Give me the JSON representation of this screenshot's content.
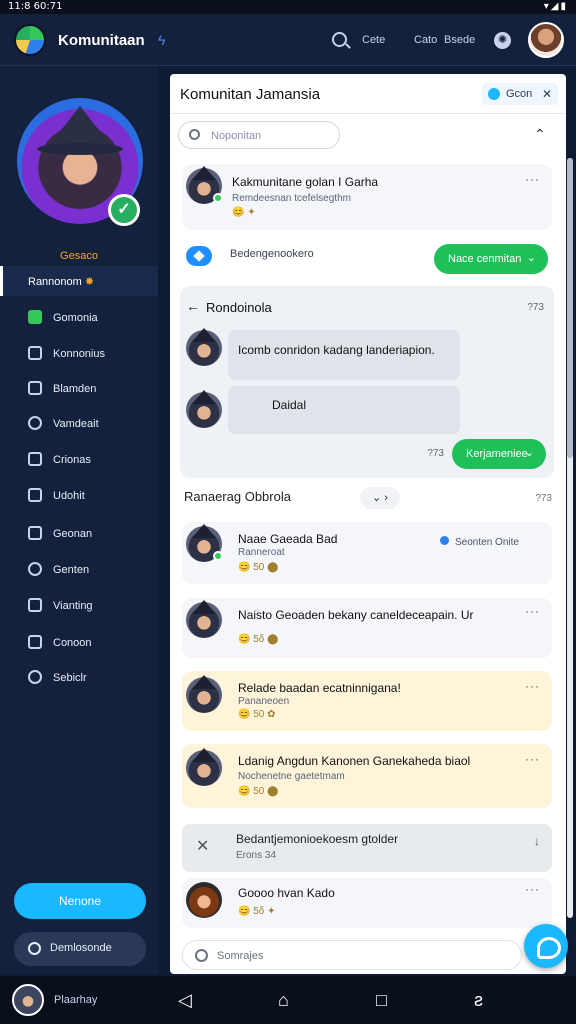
{
  "status": {
    "time": "11:8 60:71",
    "icons": "▾◢▮"
  },
  "appbar": {
    "title": "Komunitaan",
    "action1": "Cete",
    "action2": "Cato",
    "action3": "Bsede"
  },
  "sidebar": {
    "username": "Gesaco",
    "user_row": "Rannonom",
    "items": [
      {
        "label": "Gomonia",
        "icon": "home-icon"
      },
      {
        "label": "Konnonius",
        "icon": "community-icon"
      },
      {
        "label": "Blamden",
        "icon": "feather-icon"
      },
      {
        "label": "Vamdeait",
        "icon": "target-icon"
      },
      {
        "label": "Crionas",
        "icon": "calendar-icon"
      },
      {
        "label": "Udohit",
        "icon": "house-icon"
      },
      {
        "label": "Geonan",
        "icon": "building-icon"
      },
      {
        "label": "Genten",
        "icon": "chat-icon"
      },
      {
        "label": "Vianting",
        "icon": "store-icon"
      },
      {
        "label": "Conoon",
        "icon": "folder-icon"
      },
      {
        "label": "Sebiclr",
        "icon": "settings-icon"
      }
    ],
    "new_button": "Nenone",
    "secondary_button": "Demlosonde"
  },
  "main": {
    "title": "Komunitan Jamansia",
    "chip_label": "Gcon",
    "search_placeholder": "Noponitan",
    "post1": {
      "title": "Kakmunitane golan I Garha",
      "subtitle": "Remdeesnan tcefelsegthm",
      "emojis": "😊 ✦"
    },
    "toggle_label": "Bedengenookero",
    "follow_button": "Nace cenmitan",
    "thread": {
      "title": "Rondoinola",
      "q": "?73",
      "msg1": "Icomb conridon kadang landeriapion.",
      "msg2": "Daidal",
      "q2": "?73",
      "reply_button": "Kerjameniee"
    },
    "section_title": "Ranaerag Obbrola",
    "section_q": "?73",
    "posts": [
      {
        "title": "Naae Gaeada Bad",
        "sub": "Ranneroat",
        "emojis": "😊 50 ⬤",
        "online": "Seonten Onite"
      },
      {
        "title": "Naisto Geoaden bekany caneldeceapain. Ur",
        "sub": "",
        "emojis": "😊 5δ ⬤"
      },
      {
        "title": "Relade baadan ecatninnigana!",
        "sub": "Pananeoen",
        "emojis": "😊 50 ✿"
      },
      {
        "title": "Ldanig Angdun Kanonen Ganekaheda biaol",
        "sub": "Nochenetne gaetetmam",
        "emojis": "😊 50 ⬤"
      }
    ],
    "dismiss": {
      "title": "Bedantjemonioekoesm gtolder",
      "sub": "Erons 34"
    },
    "last_post": {
      "title": "Goooo hvan Kado",
      "emojis": "😊 5δ ✦"
    },
    "compose_placeholder": "Somrajes"
  },
  "bottom": {
    "profile_label": "Plaarhay"
  }
}
